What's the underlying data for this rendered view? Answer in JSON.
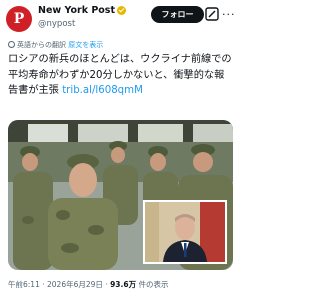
{
  "header": {
    "avatar_text": "P",
    "name": "New York Post",
    "handle": "@nypost",
    "follow_label": "フォロー",
    "more_label": "···"
  },
  "translation": {
    "label": "英語からの翻訳",
    "show_original": "原文を表示"
  },
  "post": {
    "text": "ロシアの新兵のほとんどは、ウクライナ前線での平均寿命がわずか20分しかないと、衝撃的な報告書が主張 ",
    "link": "trib.al/l608qmM"
  },
  "footer": {
    "time": "午前6:11",
    "separator": "·",
    "date": "2026年6月29日",
    "views_count": "93.6万",
    "views_label": "件の表示"
  },
  "colors": {
    "accent": "#1d9bf0",
    "brand": "#cf2027",
    "verified": "#e6b800"
  }
}
